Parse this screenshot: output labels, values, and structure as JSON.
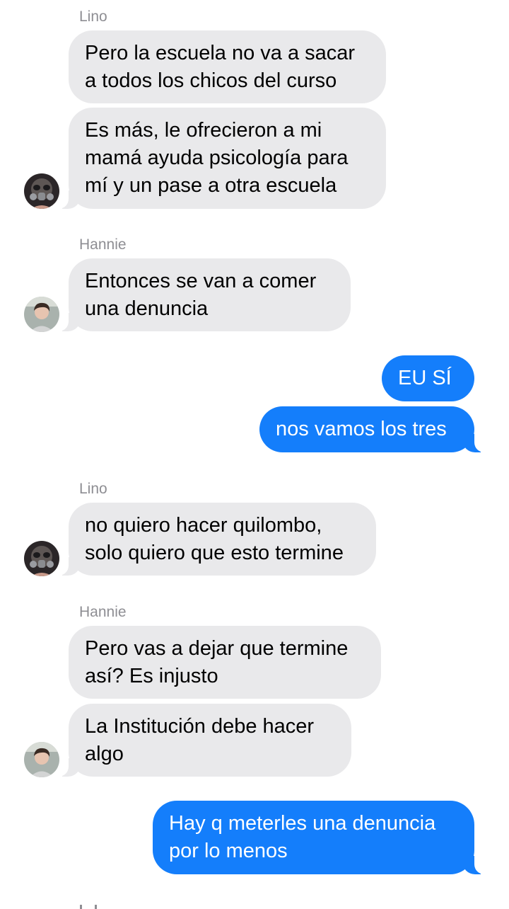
{
  "participants": {
    "lino": {
      "name": "Lino",
      "avatar_icon": "gas-mask-avatar-icon"
    },
    "hannie": {
      "name": "Hannie",
      "avatar_icon": "person-portrait-avatar-icon"
    }
  },
  "messages": [
    {
      "sender": "Lino",
      "direction": "incoming",
      "lines": [
        "Pero la escuela no va a sacar",
        "a todos los chicos del curso"
      ]
    },
    {
      "sender": "Lino",
      "direction": "incoming",
      "lines": [
        "Es más, le ofrecieron a mi",
        "mamá ayuda psicología para",
        "mí y un pase a otra escuela"
      ]
    },
    {
      "sender": "Hannie",
      "direction": "incoming",
      "lines": [
        "Entonces se van a comer",
        "una denuncia"
      ]
    },
    {
      "sender": "me",
      "direction": "outgoing",
      "lines": [
        "EU SÍ"
      ]
    },
    {
      "sender": "me",
      "direction": "outgoing",
      "lines": [
        "nos vamos los tres"
      ]
    },
    {
      "sender": "Lino",
      "direction": "incoming",
      "lines": [
        "no quiero hacer quilombo,",
        "solo quiero que esto termine"
      ]
    },
    {
      "sender": "Hannie",
      "direction": "incoming",
      "lines": [
        "Pero vas a dejar que termine",
        "así? Es injusto"
      ]
    },
    {
      "sender": "Hannie",
      "direction": "incoming",
      "lines": [
        "La Institución debe hacer",
        "algo"
      ]
    },
    {
      "sender": "me",
      "direction": "outgoing",
      "lines": [
        "Hay q meterles una denuncia",
        "por lo menos"
      ]
    }
  ],
  "colors": {
    "incoming_bubble": "#e9e9eb",
    "outgoing_bubble": "#147efb",
    "sender_label": "#8e8e93",
    "background": "#ffffff"
  }
}
